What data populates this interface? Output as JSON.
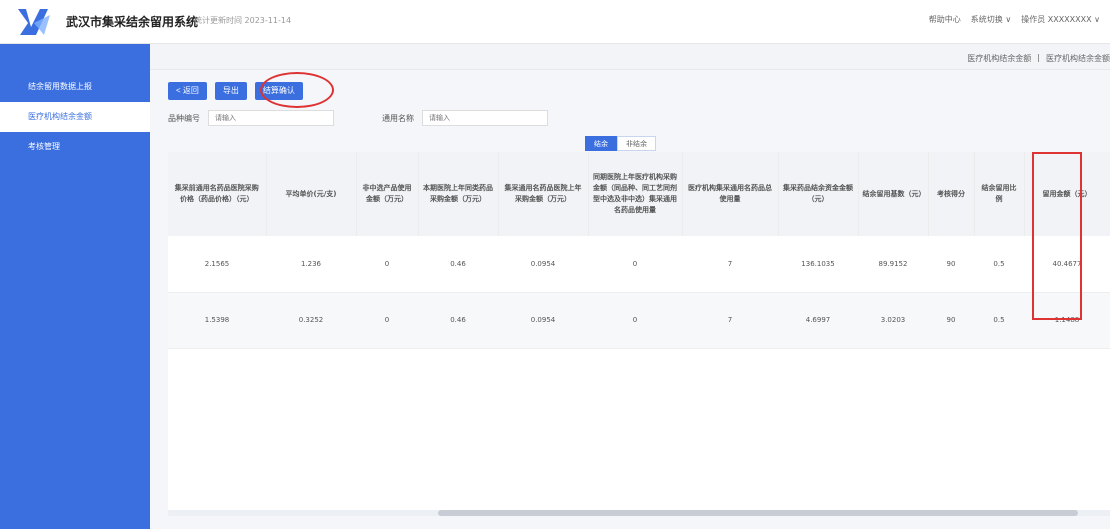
{
  "header": {
    "title": "武汉市集采结余留用系统",
    "subtitle": "统计更新时间 2023-11-14",
    "right_links": [
      "帮助中心",
      "系统切换 ∨",
      "操作员 XXXXXXXX ∨"
    ]
  },
  "sidebar": {
    "items": [
      {
        "label": "结余留用数据上报"
      },
      {
        "label": "医疗机构结余金额"
      },
      {
        "label": "考核管理"
      }
    ]
  },
  "breadcrumb": {
    "items": [
      "医疗机构结余金额",
      "医疗机构结余金额"
    ]
  },
  "toolbar": {
    "back_label": "< 返回",
    "export_label": "导出",
    "confirm_label": "结算确认"
  },
  "filters": {
    "code_label": "品种编号",
    "code_placeholder": "请输入",
    "name_label": "通用名称",
    "name_placeholder": "请输入"
  },
  "segment_tabs": [
    {
      "label": "结余",
      "active": true
    },
    {
      "label": "非结余",
      "active": false
    }
  ],
  "table": {
    "columns": [
      "集采前通用名药品医院采购价格（药品价格）（元）",
      "平均单价(元/支)",
      "非中选产品使用金额（万元）",
      "本期医院上年同类药品采购金额（万元）",
      "集采通用名药品医院上年采购金额（万元）",
      "同期医院上年医疗机构采购金额（同品种、同工艺同剂型中选及非中选）集采通用名药品使用量",
      "医疗机构集采通用名药品总使用量",
      "集采药品结余资金金额（元）",
      "结余留用基数（元）",
      "考核得分",
      "结余留用比例",
      "留用金额（元）"
    ],
    "rows": [
      [
        "2.1565",
        "1.236",
        "0",
        "0.46",
        "0.0954",
        "0",
        "7",
        "136.1035",
        "89.9152",
        "90",
        "0.5",
        "40.4677"
      ],
      [
        "1.5398",
        "0.3252",
        "0",
        "0.46",
        "0.0954",
        "0",
        "7",
        "4.6997",
        "3.0203",
        "90",
        "0.5",
        "1.1488"
      ]
    ]
  },
  "colors": {
    "accent": "#3b6fe0",
    "annotation": "#d33333"
  }
}
